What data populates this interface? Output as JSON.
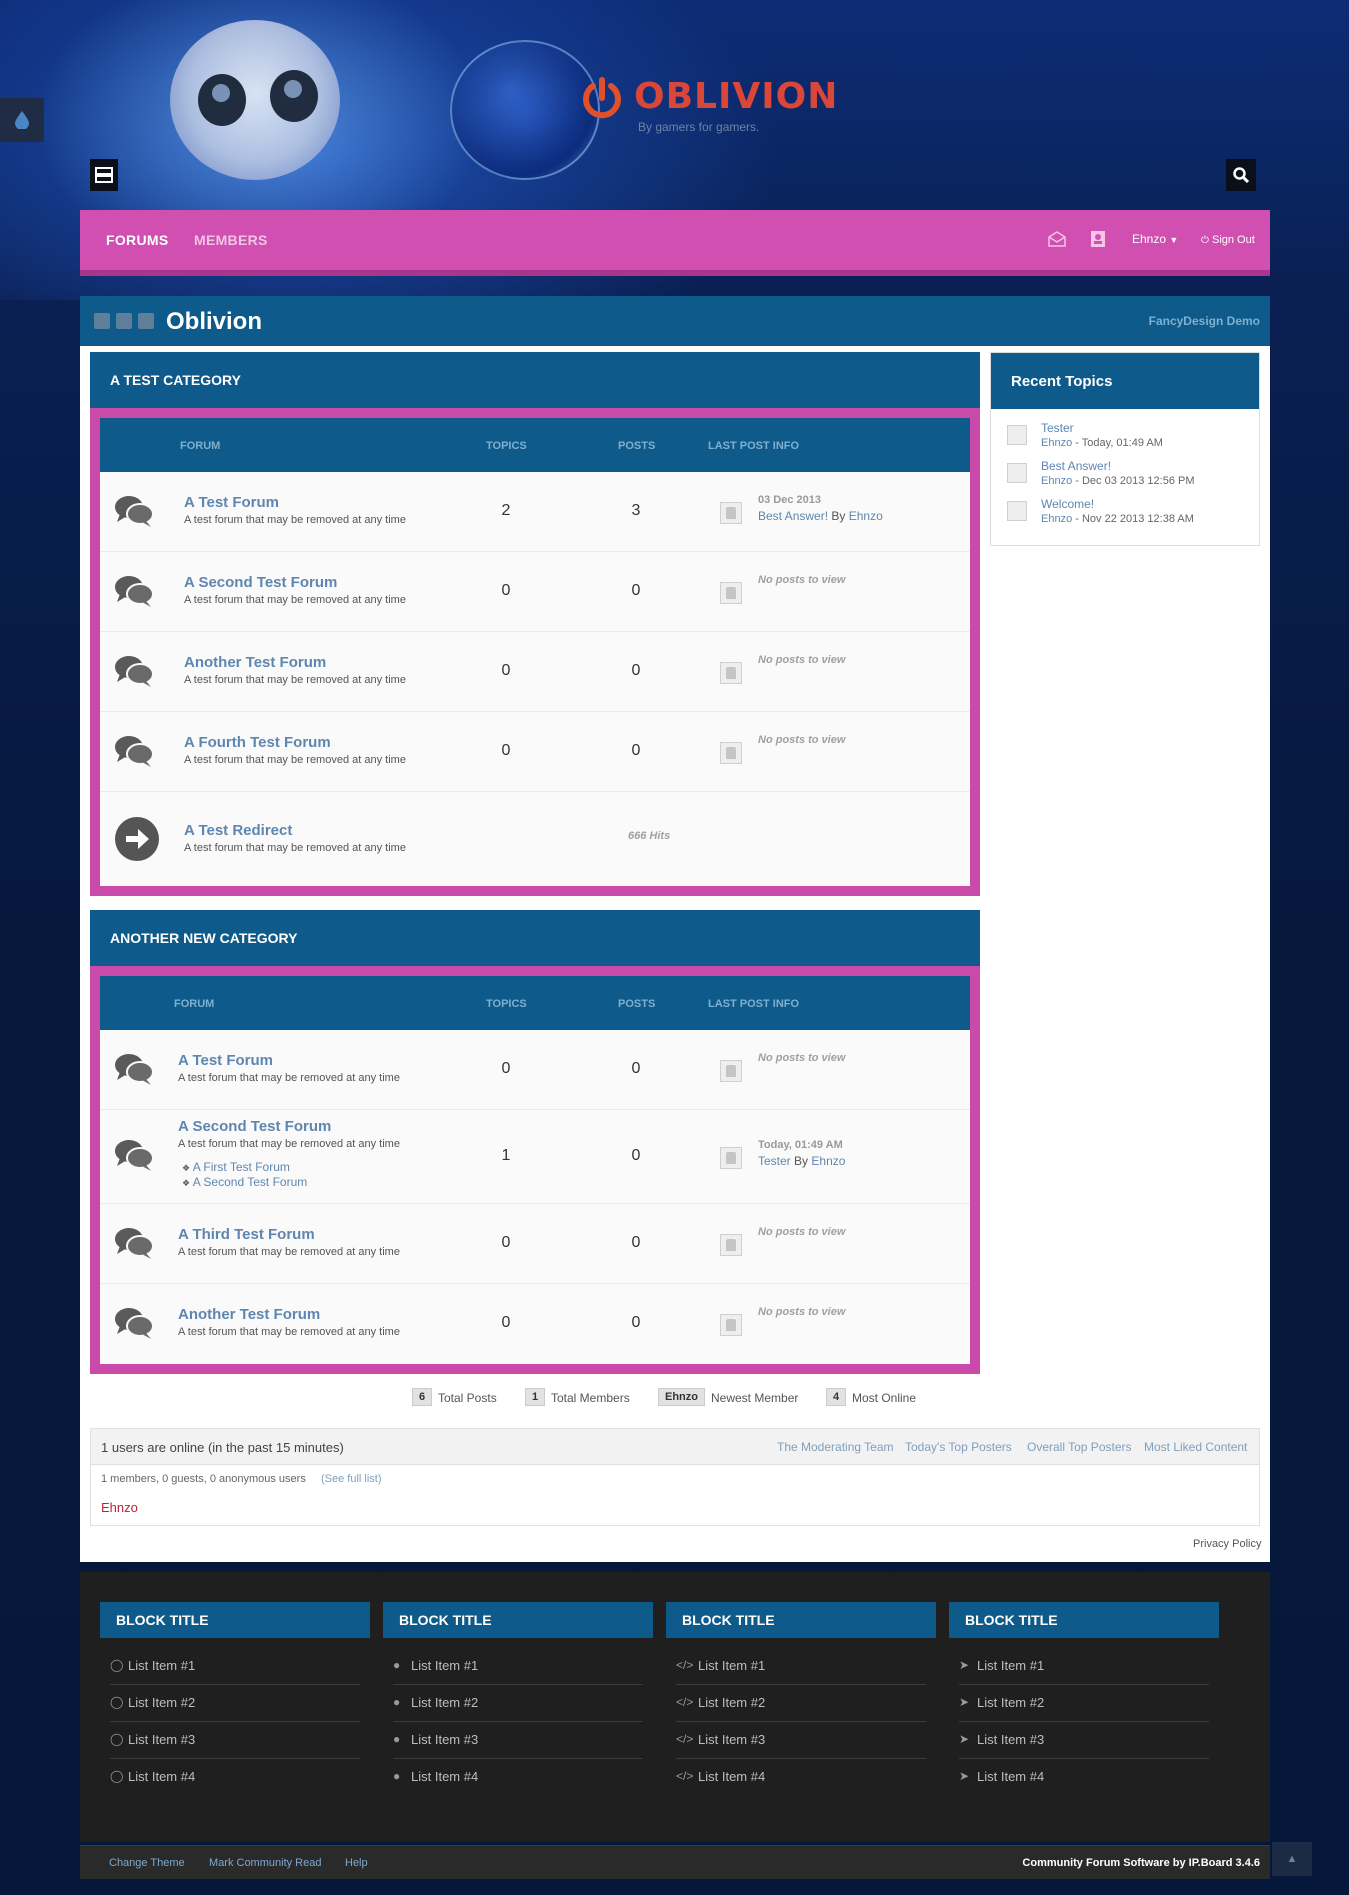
{
  "header": {
    "logo_text": "OBLIVION",
    "tagline": "By gamers for gamers."
  },
  "nav": {
    "forums": "FORUMS",
    "members": "MEMBERS",
    "user": "Ehnzo",
    "signout": "Sign Out"
  },
  "page": {
    "title": "Oblivion",
    "demo_link": "FancyDesign Demo"
  },
  "table_headers": {
    "forum": "FORUM",
    "topics": "TOPICS",
    "posts": "POSTS",
    "last_post": "LAST POST INFO"
  },
  "categories": [
    {
      "title": "A TEST CATEGORY",
      "forums": [
        {
          "name": "A Test Forum",
          "desc": "A test forum that may be removed at any time",
          "topics": "2",
          "posts": "3",
          "last_date": "03 Dec 2013",
          "last_topic": "Best Answer!",
          "by": "By",
          "last_user": "Ehnzo"
        },
        {
          "name": "A Second Test Forum",
          "desc": "A test forum that may be removed at any time",
          "topics": "0",
          "posts": "0",
          "noposts": "No posts to view"
        },
        {
          "name": "Another Test Forum",
          "desc": "A test forum that may be removed at any time",
          "topics": "0",
          "posts": "0",
          "noposts": "No posts to view"
        },
        {
          "name": "A Fourth Test Forum",
          "desc": "A test forum that may be removed at any time",
          "topics": "0",
          "posts": "0",
          "noposts": "No posts to view"
        },
        {
          "name": "A Test Redirect",
          "desc": "A test forum that may be removed at any time",
          "hits": "666 Hits"
        }
      ]
    },
    {
      "title": "ANOTHER NEW CATEGORY",
      "forums": [
        {
          "name": "A Test Forum",
          "desc": "A test forum that may be removed at any time",
          "topics": "0",
          "posts": "0",
          "noposts": "No posts to view"
        },
        {
          "name": "A Second Test Forum",
          "desc": "A test forum that may be removed at any time",
          "topics": "1",
          "posts": "0",
          "last_date": "Today, 01:49 AM",
          "last_topic": "Tester",
          "by": "By",
          "last_user": "Ehnzo",
          "subforums": [
            "A First Test Forum",
            "A Second Test Forum"
          ]
        },
        {
          "name": "A Third Test Forum",
          "desc": "A test forum that may be removed at any time",
          "topics": "0",
          "posts": "0",
          "noposts": "No posts to view"
        },
        {
          "name": "Another Test Forum",
          "desc": "A test forum that may be removed at any time",
          "topics": "0",
          "posts": "0",
          "noposts": "No posts to view"
        }
      ]
    }
  ],
  "sidebar": {
    "title": "Recent Topics",
    "topics": [
      {
        "title": "Tester",
        "user": "Ehnzo",
        "time": " - Today, 01:49 AM"
      },
      {
        "title": "Best Answer!",
        "user": "Ehnzo",
        "time": " - Dec 03 2013 12:56 PM"
      },
      {
        "title": "Welcome!",
        "user": "Ehnzo",
        "time": " - Nov 22 2013 12:38 AM"
      }
    ]
  },
  "stats": {
    "posts_num": "6",
    "posts_lbl": "Total Posts",
    "members_num": "1",
    "members_lbl": "Total Members",
    "newest_num": "Ehnzo",
    "newest_lbl": "Newest Member",
    "online_num": "4",
    "online_lbl": "Most Online"
  },
  "online": {
    "heading": "1 users are online (in the past 15 minutes)",
    "links": [
      "The Moderating Team",
      "Today's Top Posters",
      "Overall Top Posters",
      "Most Liked Content"
    ],
    "counts": "1 members, 0 guests, 0 anonymous users",
    "see_full": "(See full list)",
    "user": "Ehnzo"
  },
  "privacy": "Privacy Policy",
  "footer_blocks": [
    {
      "title": "BLOCK TITLE",
      "icon": "comment-outline-icon",
      "items": [
        "List Item #1",
        "List Item #2",
        "List Item #3",
        "List Item #4"
      ]
    },
    {
      "title": "BLOCK TITLE",
      "icon": "comment-icon",
      "items": [
        "List Item #1",
        "List Item #2",
        "List Item #3",
        "List Item #4"
      ]
    },
    {
      "title": "BLOCK TITLE",
      "icon": "code-icon",
      "items": [
        "List Item #1",
        "List Item #2",
        "List Item #3",
        "List Item #4"
      ]
    },
    {
      "title": "BLOCK TITLE",
      "icon": "location-arrow-icon",
      "items": [
        "List Item #1",
        "List Item #2",
        "List Item #3",
        "List Item #4"
      ]
    }
  ],
  "bottom": {
    "change_theme": "Change Theme",
    "mark_read": "Mark Community Read",
    "help": "Help",
    "credit": "Community Forum Software by IP.Board 3.4.6"
  },
  "colors": {
    "nav_pink": "#d04fb0",
    "category_blue": "#0e5a8a",
    "link_blue": "#5f86b0",
    "logo_red": "#d9463a"
  }
}
